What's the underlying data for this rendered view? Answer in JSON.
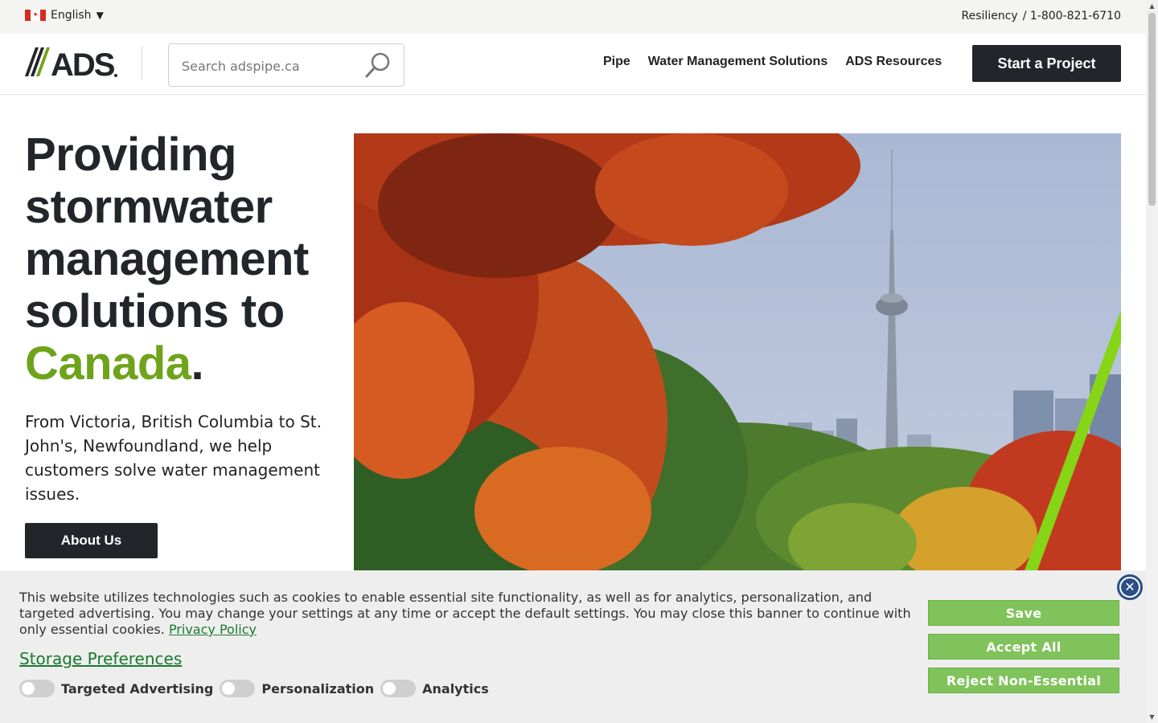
{
  "topbar": {
    "language": "English",
    "caret": "▼",
    "flag_symbol": "✦",
    "links": [
      "Resiliency",
      "/ 1-800-821-6710"
    ]
  },
  "header": {
    "logo_text": "ADS",
    "search_placeholder": "Search adspipe.ca",
    "nav": [
      "Pipe",
      "Water Management Solutions",
      "ADS Resources"
    ],
    "cta": "Start a Project"
  },
  "hero": {
    "headline_lines": [
      "Providing",
      "stormwater",
      "management",
      "solutions to"
    ],
    "headline_accent": "Canada",
    "headline_period": ".",
    "subtext": "From Victoria, British Columbia to St. John's, Newfoundland, we help customers solve water management issues.",
    "button": "About Us"
  },
  "cookie_banner": {
    "text": "This website utilizes technologies such as cookies to enable essential site functionality, as well as for analytics, personalization, and targeted advertising. You may change your settings at any time or accept the default settings. You may close this banner to continue with only essential cookies.",
    "privacy_link": "Privacy Policy",
    "storage_preferences": "Storage Preferences",
    "toggles": [
      {
        "label": "Targeted Advertising",
        "on": false
      },
      {
        "label": "Personalization",
        "on": false
      },
      {
        "label": "Analytics",
        "on": false
      }
    ],
    "buttons": {
      "save": "Save",
      "accept": "Accept All",
      "reject": "Reject Non-Essential"
    },
    "close_glyph": "✕"
  },
  "colors": {
    "accent_green": "#6fa31a",
    "dark": "#22262a",
    "cookie_button": "#7fc35a",
    "link_green": "#1a7a2e"
  },
  "icons": [
    "flag-canada-icon",
    "caret-down-icon",
    "search-icon",
    "close-icon"
  ]
}
